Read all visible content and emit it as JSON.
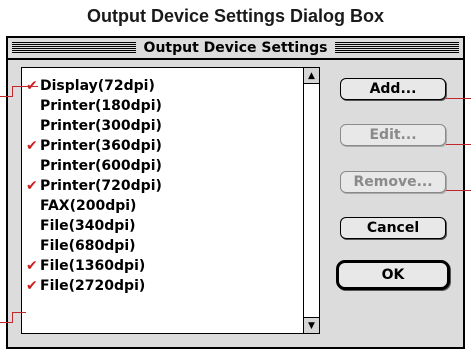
{
  "caption": "Output Device Settings Dialog Box",
  "dialog": {
    "title": "Output Device Settings",
    "list": {
      "items": [
        {
          "label": "Display(72dpi)",
          "checked": true
        },
        {
          "label": "Printer(180dpi)",
          "checked": false
        },
        {
          "label": "Printer(300dpi)",
          "checked": false
        },
        {
          "label": "Printer(360dpi)",
          "checked": true
        },
        {
          "label": "Printer(600dpi)",
          "checked": false
        },
        {
          "label": "Printer(720dpi)",
          "checked": true
        },
        {
          "label": "FAX(200dpi)",
          "checked": false
        },
        {
          "label": "File(340dpi)",
          "checked": false
        },
        {
          "label": "File(680dpi)",
          "checked": false
        },
        {
          "label": "File(1360dpi)",
          "checked": true
        },
        {
          "label": "File(2720dpi)",
          "checked": true
        }
      ]
    },
    "buttons": {
      "add": "Add...",
      "edit": "Edit...",
      "remove": "Remove...",
      "cancel": "Cancel",
      "ok": "OK"
    }
  },
  "colors": {
    "checkmark": "#cc1f1f",
    "callout": "#c0282d",
    "dialog_bg": "#dcdcdc"
  },
  "icons": {
    "checkmark": "checkmark-icon",
    "scroll_up": "scroll-up-arrow-icon",
    "scroll_down": "scroll-down-arrow-icon"
  }
}
